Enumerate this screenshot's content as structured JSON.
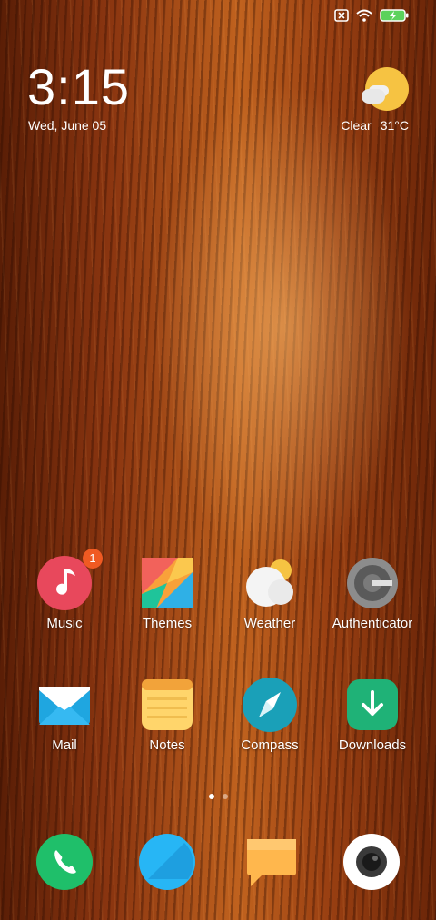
{
  "status_bar": {
    "icons": [
      "sim-none-icon",
      "wifi-icon",
      "battery-charging-icon"
    ],
    "battery_color": "#5bd25b"
  },
  "lockscreen": {
    "time": "3:15",
    "date": "Wed, June 05"
  },
  "weather_widget": {
    "condition": "Clear",
    "temperature": "31°C"
  },
  "apps": [
    {
      "name": "Music",
      "badge": "1"
    },
    {
      "name": "Themes"
    },
    {
      "name": "Weather"
    },
    {
      "name": "Authenticator"
    },
    {
      "name": "Mail"
    },
    {
      "name": "Notes"
    },
    {
      "name": "Compass"
    },
    {
      "name": "Downloads"
    }
  ],
  "page_indicator": {
    "pages": 2,
    "current": 1
  },
  "dock": [
    "phone-icon",
    "browser-icon",
    "messaging-icon",
    "camera-icon"
  ],
  "colors": {
    "music": "#e8485c",
    "compass": "#1aa0b8",
    "downloads": "#1fb277",
    "phone": "#1fbf6a",
    "browser": "#27b6f5",
    "messaging": "#ffb74d",
    "badge": "#f05a22"
  }
}
